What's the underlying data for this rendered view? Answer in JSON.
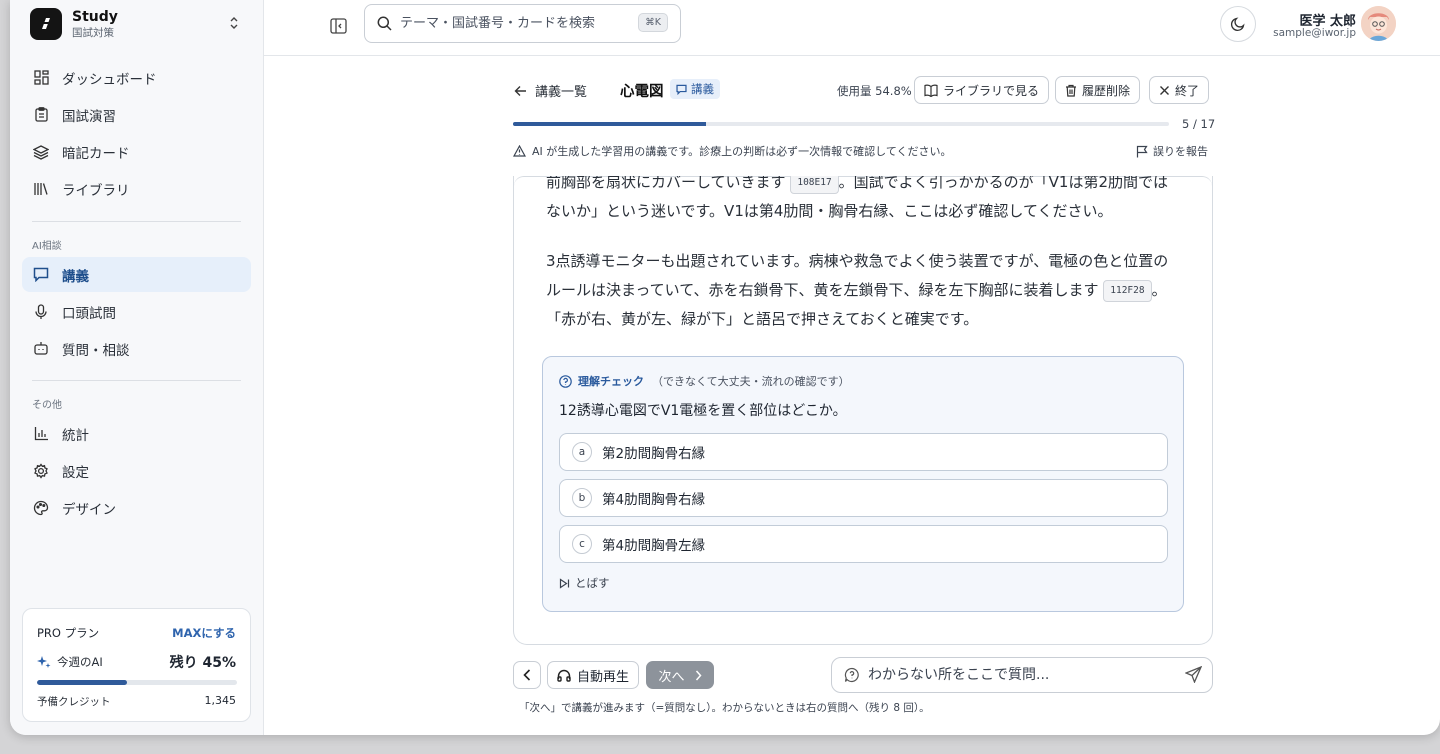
{
  "brand": {
    "name": "Study",
    "subtitle": "国試対策"
  },
  "sidebar": {
    "items": [
      {
        "label": "ダッシュボード",
        "icon": "dashboard-icon"
      },
      {
        "label": "国試演習",
        "icon": "clipboard-icon"
      },
      {
        "label": "暗記カード",
        "icon": "layers-icon"
      },
      {
        "label": "ライブラリ",
        "icon": "library-icon"
      }
    ],
    "ai_section": "AI相談",
    "ai_items": [
      {
        "label": "講義",
        "icon": "chat-icon",
        "active": true
      },
      {
        "label": "口頭試問",
        "icon": "mic-icon"
      },
      {
        "label": "質問・相談",
        "icon": "bot-icon"
      }
    ],
    "other_section": "その他",
    "other_items": [
      {
        "label": "統計",
        "icon": "chart-icon"
      },
      {
        "label": "設定",
        "icon": "gear-icon"
      },
      {
        "label": "デザイン",
        "icon": "palette-icon"
      }
    ]
  },
  "plan": {
    "title": "PRO プラン",
    "upgrade": "MAXにする",
    "ai_label": "今週のAI",
    "remaining": "残り 45%",
    "remaining_fraction": 0.45,
    "credit_label": "予備クレジット",
    "credit_value": "1,345"
  },
  "topbar": {
    "search_placeholder": "テーマ・国試番号・カードを検索",
    "shortcut": "⌘K",
    "user_name": "医学 太郎",
    "user_email": "sample@iwor.jp"
  },
  "lecture": {
    "back": "講義一覧",
    "title": "心電図",
    "badge": "講義",
    "usage": "使用量 54.8%",
    "library_btn": "ライブラリで見る",
    "delete_btn": "履歴削除",
    "end_btn": "終了",
    "progress_fraction": 0.294,
    "page": "5 / 17",
    "notice": "AI が生成した学習用の講義です。診療上の判断は必ず一次情報で確認してください。",
    "report": "誤りを報告",
    "para1_a": "前胸部を扇状にカバーしていきます",
    "para1_ref": "108E17",
    "para1_b": "。国試でよく引っかかるのが「V1は第2肋間ではないか」という迷いです。V1は第4肋間・胸骨右縁、ここは必ず確認してください。",
    "para2_a": "3点誘導モニターも出題されています。病棟や救急でよく使う装置ですが、電極の色と位置のルールは決まっていて、赤を右鎖骨下、黄を左鎖骨下、緑を左下胸部に装着します",
    "para2_ref": "112F28",
    "para2_b": "。「赤が右、黄が左、緑が下」と語呂で押さえておくと確実です。"
  },
  "quiz": {
    "title": "理解チェック",
    "subtitle": "（できなくて大丈夫・流れの確認です）",
    "question": "12誘導心電図でV1電極を置く部位はどこか。",
    "options": [
      {
        "letter": "a",
        "text": "第2肋間胸骨右縁"
      },
      {
        "letter": "b",
        "text": "第4肋間胸骨右縁"
      },
      {
        "letter": "c",
        "text": "第4肋間胸骨左縁"
      }
    ],
    "skip": "とばす"
  },
  "bottom": {
    "autoplay": "自動再生",
    "next": "次へ",
    "ask_placeholder": "わからない所をここで質問...",
    "hint": "「次へ」で講義が進みます（=質問なし）。わからないときは右の質問へ（残り 8 回）。"
  }
}
